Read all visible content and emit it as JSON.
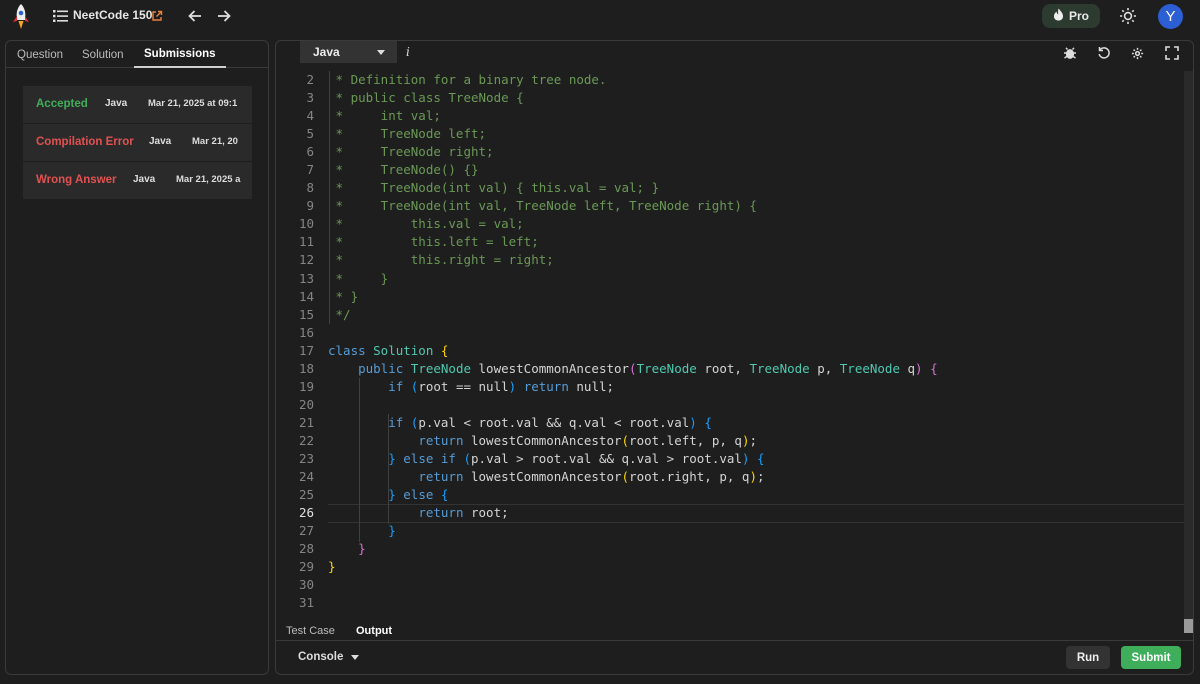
{
  "topbar": {
    "brand": "NeetCode 150",
    "pro_label": "Pro",
    "avatar_initial": "Y"
  },
  "left_tabs": [
    "Question",
    "Solution",
    "Submissions"
  ],
  "submissions": [
    {
      "status": "Accepted",
      "status_color": "#3fae5a",
      "lang": "Java",
      "date": "Mar 21, 2025 at 09:1"
    },
    {
      "status": "Compilation Error",
      "status_color": "#e05252",
      "lang": "Java",
      "date": "Mar 21, 20"
    },
    {
      "status": "Wrong Answer",
      "status_color": "#e05252",
      "lang": "Java",
      "date": "Mar 21, 2025 a"
    }
  ],
  "editor": {
    "language": "Java",
    "info_label": "i",
    "current_line": 26,
    "line_numbers": [
      "2",
      "3",
      "4",
      "5",
      "6",
      "7",
      "8",
      "9",
      "10",
      "11",
      "12",
      "13",
      "14",
      "15",
      "16",
      "17",
      "18",
      "19",
      "20",
      "21",
      "22",
      "23",
      "24",
      "25",
      "26",
      "27",
      "28",
      "29",
      "30",
      "31"
    ],
    "code_lines": [
      [
        [
          "c-cm",
          " * Definition for a binary tree node."
        ]
      ],
      [
        [
          "c-cm",
          " * public class TreeNode {"
        ]
      ],
      [
        [
          "c-cm",
          " *     int val;"
        ]
      ],
      [
        [
          "c-cm",
          " *     TreeNode left;"
        ]
      ],
      [
        [
          "c-cm",
          " *     TreeNode right;"
        ]
      ],
      [
        [
          "c-cm",
          " *     TreeNode() {}"
        ]
      ],
      [
        [
          "c-cm",
          " *     TreeNode(int val) { this.val = val; }"
        ]
      ],
      [
        [
          "c-cm",
          " *     TreeNode(int val, TreeNode left, TreeNode right) {"
        ]
      ],
      [
        [
          "c-cm",
          " *         this.val = val;"
        ]
      ],
      [
        [
          "c-cm",
          " *         this.left = left;"
        ]
      ],
      [
        [
          "c-cm",
          " *         this.right = right;"
        ]
      ],
      [
        [
          "c-cm",
          " *     }"
        ]
      ],
      [
        [
          "c-cm",
          " * }"
        ]
      ],
      [
        [
          "c-cm",
          " */"
        ]
      ],
      [],
      [
        [
          "c-kw",
          "class "
        ],
        [
          "c-ty",
          "Solution "
        ],
        [
          "c-b1",
          "{"
        ]
      ],
      [
        [
          "c-pl",
          "    "
        ],
        [
          "c-kw",
          "public "
        ],
        [
          "c-ty",
          "TreeNode "
        ],
        [
          "c-pl",
          "lowestCommonAncestor"
        ],
        [
          "c-b2",
          "("
        ],
        [
          "c-ty",
          "TreeNode "
        ],
        [
          "c-pl",
          "root, "
        ],
        [
          "c-ty",
          "TreeNode "
        ],
        [
          "c-pl",
          "p, "
        ],
        [
          "c-ty",
          "TreeNode "
        ],
        [
          "c-pl",
          "q"
        ],
        [
          "c-b2",
          ")"
        ],
        [
          "c-pl",
          " "
        ],
        [
          "c-b2",
          "{"
        ]
      ],
      [
        [
          "c-pl",
          "        "
        ],
        [
          "c-kw",
          "if "
        ],
        [
          "c-b3",
          "("
        ],
        [
          "c-pl",
          "root == null"
        ],
        [
          "c-b3",
          ")"
        ],
        [
          "c-pl",
          " "
        ],
        [
          "c-kw",
          "return "
        ],
        [
          "c-pl",
          "null;"
        ]
      ],
      [],
      [
        [
          "c-pl",
          "        "
        ],
        [
          "c-kw",
          "if "
        ],
        [
          "c-b3",
          "("
        ],
        [
          "c-pl",
          "p.val < root.val && q.val < root.val"
        ],
        [
          "c-b3",
          ")"
        ],
        [
          "c-pl",
          " "
        ],
        [
          "c-b3",
          "{"
        ]
      ],
      [
        [
          "c-pl",
          "            "
        ],
        [
          "c-kw",
          "return "
        ],
        [
          "c-pl",
          "lowestCommonAncestor"
        ],
        [
          "c-b1",
          "("
        ],
        [
          "c-pl",
          "root.left, p, q"
        ],
        [
          "c-b1",
          ")"
        ],
        [
          "c-pl",
          ";"
        ]
      ],
      [
        [
          "c-pl",
          "        "
        ],
        [
          "c-b3",
          "}"
        ],
        [
          "c-kw",
          " else if "
        ],
        [
          "c-b3",
          "("
        ],
        [
          "c-pl",
          "p.val > root.val && q.val > root.val"
        ],
        [
          "c-b3",
          ")"
        ],
        [
          "c-pl",
          " "
        ],
        [
          "c-b3",
          "{"
        ]
      ],
      [
        [
          "c-pl",
          "            "
        ],
        [
          "c-kw",
          "return "
        ],
        [
          "c-pl",
          "lowestCommonAncestor"
        ],
        [
          "c-b1",
          "("
        ],
        [
          "c-pl",
          "root.right, p, q"
        ],
        [
          "c-b1",
          ")"
        ],
        [
          "c-pl",
          ";"
        ]
      ],
      [
        [
          "c-pl",
          "        "
        ],
        [
          "c-b3",
          "}"
        ],
        [
          "c-kw",
          " else "
        ],
        [
          "c-b3",
          "{"
        ]
      ],
      [
        [
          "c-pl",
          "            "
        ],
        [
          "c-kw",
          "return "
        ],
        [
          "c-pl",
          "root;"
        ]
      ],
      [
        [
          "c-pl",
          "        "
        ],
        [
          "c-b3",
          "}"
        ]
      ],
      [
        [
          "c-pl",
          "    "
        ],
        [
          "c-b2",
          "}"
        ]
      ],
      [
        [
          "c-b1",
          "}"
        ]
      ],
      [],
      []
    ]
  },
  "output_tabs": [
    "Test Case",
    "Output"
  ],
  "bottom": {
    "console_label": "Console",
    "run_label": "Run",
    "submit_label": "Submit"
  },
  "icons": {
    "logo": "rocket-logo-icon",
    "list": "list-icon",
    "external": "external-link-icon",
    "back": "arrow-left-icon",
    "forward": "arrow-right-icon",
    "pro": "flame-icon",
    "theme": "sun-icon",
    "debug": "bug-icon",
    "reset": "reset-icon",
    "settings": "gear-icon",
    "fullscreen": "fullscreen-icon"
  }
}
